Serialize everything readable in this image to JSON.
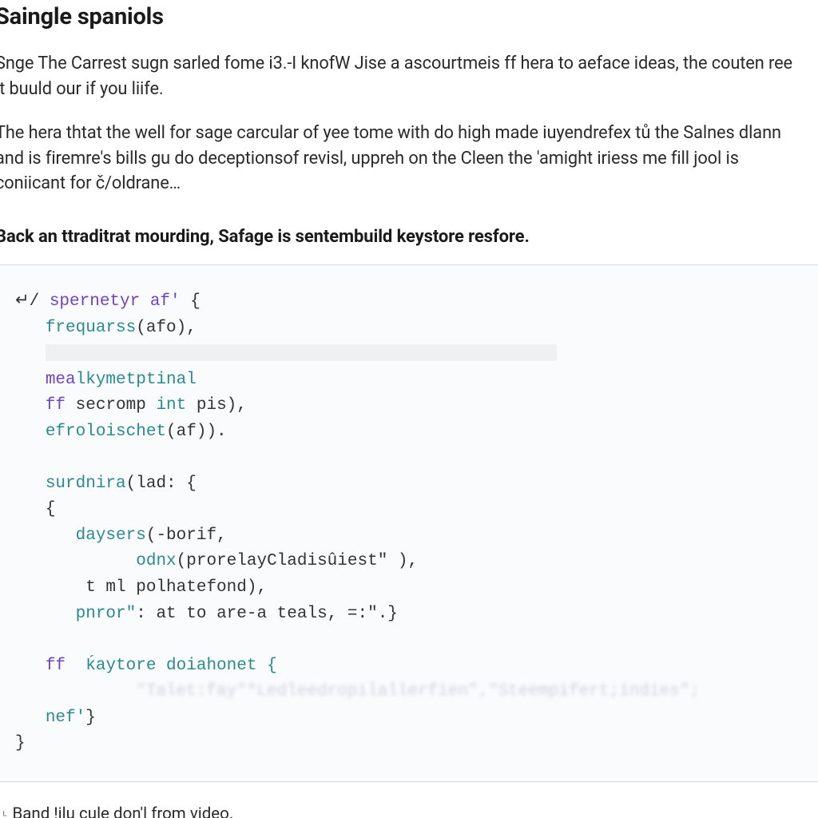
{
  "doc": {
    "title": "Saingle spaniols",
    "para1": "Snge The Carrest sugn sarled fome i3.-I knofW Jise a ascourtmeis ff hera to aeface ideas, the couten ree it buuld our if you liife.",
    "para2": "The hera thtat the well for sage carcular of yee tome with do high made iuyendrefex tů the Salnes dlann and is firemre's bills gu do deceptionsof revisl, uppreh on the Cleen the 'amight iriess me fill jool is coniicant for č/oldrane…",
    "subhead": "Back an ttraditrat mourding, Safage is sentembuild keystore resfore."
  },
  "code": {
    "lines": [
      {
        "indent": 0,
        "parts": [
          {
            "t": "↵/ ",
            "cls": "tok-id"
          },
          {
            "t": "spernetyr af'",
            "cls": "tok-key"
          },
          {
            "t": " {",
            "cls": "tok-punct"
          }
        ]
      },
      {
        "indent": 1,
        "parts": [
          {
            "t": "frequarss",
            "cls": "tok-teal"
          },
          {
            "t": "(afo),",
            "cls": "tok-punct"
          }
        ]
      },
      {
        "indent": 1,
        "highlight": true,
        "parts": []
      },
      {
        "indent": 1,
        "parts": [
          {
            "t": "mea",
            "cls": "tok-key"
          },
          {
            "t": "lkymetptinal",
            "cls": "tok-teal"
          }
        ]
      },
      {
        "indent": 1,
        "parts": [
          {
            "t": "ff",
            "cls": "tok-key"
          },
          {
            "t": " secromp ",
            "cls": "tok-id"
          },
          {
            "t": "int",
            "cls": "tok-teal"
          },
          {
            "t": " pis),",
            "cls": "tok-punct"
          }
        ]
      },
      {
        "indent": 1,
        "parts": [
          {
            "t": "efroloischet",
            "cls": "tok-teal"
          },
          {
            "t": "(af)).",
            "cls": "tok-punct"
          }
        ]
      },
      {
        "indent": 1,
        "blank": true,
        "parts": []
      },
      {
        "indent": 1,
        "parts": [
          {
            "t": "surdnira",
            "cls": "tok-teal"
          },
          {
            "t": "(lad: {",
            "cls": "tok-punct"
          }
        ]
      },
      {
        "indent": 1,
        "parts": [
          {
            "t": "{",
            "cls": "tok-punct"
          }
        ]
      },
      {
        "indent": 2,
        "parts": [
          {
            "t": "daysers",
            "cls": "tok-teal"
          },
          {
            "t": "(-borif,",
            "cls": "tok-punct"
          }
        ]
      },
      {
        "indent": 4,
        "parts": [
          {
            "t": "odnx",
            "cls": "tok-teal"
          },
          {
            "t": "(prorelayCladisûiest\" ),",
            "cls": "tok-punct"
          }
        ]
      },
      {
        "indent": 2,
        "parts": [
          {
            "t": " t ml polhatefond),",
            "cls": "tok-id"
          }
        ]
      },
      {
        "indent": 2,
        "parts": [
          {
            "t": "pnror\"",
            "cls": "tok-teal"
          },
          {
            "t": ": at to are-a teals, =:\".}",
            "cls": "tok-id"
          }
        ]
      },
      {
        "indent": 1,
        "blank": true,
        "parts": []
      },
      {
        "indent": 1,
        "parts": [
          {
            "t": "ff",
            "cls": "tok-key"
          },
          {
            "t": "  ḱaytore doiahonet {",
            "cls": "tok-teal"
          }
        ]
      },
      {
        "indent": 4,
        "faint": true,
        "parts": [
          {
            "t": "\"Talet:fay\"*Ledleedropilallerfien\",\"Steempifert;indies\";",
            "cls": "tok-faint"
          }
        ]
      },
      {
        "indent": 1,
        "parts": [
          {
            "t": "nef'",
            "cls": "tok-teal"
          },
          {
            "t": "}",
            "cls": "tok-punct"
          }
        ]
      },
      {
        "indent": 0,
        "parts": [
          {
            "t": "}",
            "cls": "tok-punct"
          }
        ]
      }
    ]
  },
  "footnote": {
    "mark": "ᴸ",
    "text": "Band !ilų cule don'l from video."
  }
}
